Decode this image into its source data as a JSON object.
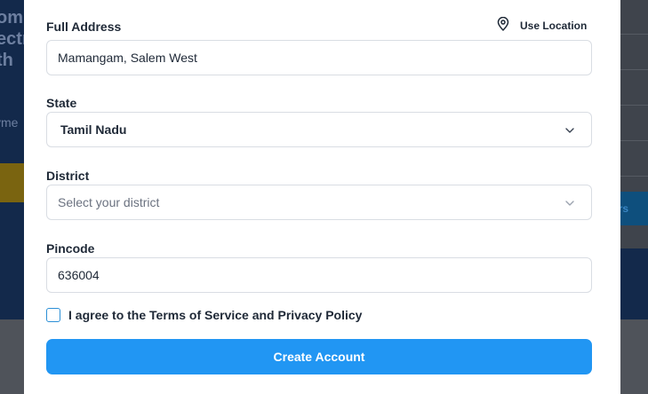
{
  "background": {
    "hero_lines": [
      "om",
      "ectr",
      "th"
    ],
    "hero_sub": "yme",
    "right_band_text": "ers"
  },
  "form": {
    "address": {
      "label": "Full Address",
      "value": "Mamangam, Salem West",
      "use_location_label": "Use Location"
    },
    "state": {
      "label": "State",
      "selected": "Tamil Nadu"
    },
    "district": {
      "label": "District",
      "placeholder": "Select your district"
    },
    "pincode": {
      "label": "Pincode",
      "value": "636004"
    },
    "terms": {
      "label": "I agree to the Terms of Service and Privacy Policy",
      "checked": false
    },
    "submit_label": "Create Account"
  },
  "colors": {
    "accent": "#2196f3",
    "checkbox_border": "#2b8fd6",
    "placeholder_text": "#6b7280",
    "overlay_background": "#13294b"
  },
  "icons": {
    "location": "map-pin-icon",
    "dropdown": "chevron-down-icon"
  }
}
